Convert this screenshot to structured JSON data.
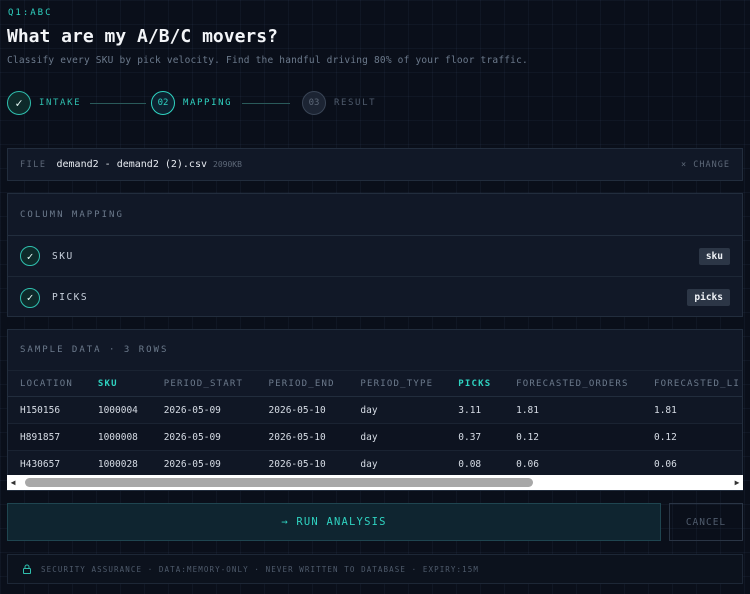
{
  "header": {
    "eyebrow": "Q1:ABC",
    "title": "What are my A/B/C movers?",
    "subtitle": "Classify every SKU by pick velocity. Find the handful driving 80% of your floor traffic."
  },
  "stepper": {
    "steps": [
      {
        "num": "✓",
        "label": "INTAKE",
        "state": "done"
      },
      {
        "num": "02",
        "label": "MAPPING",
        "state": "active"
      },
      {
        "num": "03",
        "label": "RESULT",
        "state": "todo"
      }
    ]
  },
  "file": {
    "key": "FILE",
    "name": "demand2 - demand2 (2).csv",
    "size": "2090KB",
    "change_label": "× CHANGE"
  },
  "mapping": {
    "heading": "COLUMN MAPPING",
    "rows": [
      {
        "label": "SKU",
        "value": "sku"
      },
      {
        "label": "PICKS",
        "value": "picks"
      }
    ]
  },
  "sample": {
    "heading": "SAMPLE DATA · 3 ROWS",
    "columns": [
      "LOCATION",
      "SKU",
      "PERIOD_START",
      "PERIOD_END",
      "PERIOD_TYPE",
      "PICKS",
      "FORECASTED_ORDERS",
      "FORECASTED_LI"
    ],
    "highlighted": [
      "SKU",
      "PICKS"
    ],
    "rows": [
      [
        "H150156",
        "1000004",
        "2026-05-09",
        "2026-05-10",
        "day",
        "3.11",
        "1.81",
        "1.81"
      ],
      [
        "H891857",
        "1000008",
        "2026-05-09",
        "2026-05-10",
        "day",
        "0.37",
        "0.12",
        "0.12"
      ],
      [
        "H430657",
        "1000028",
        "2026-05-09",
        "2026-05-10",
        "day",
        "0.08",
        "0.06",
        "0.06"
      ]
    ]
  },
  "actions": {
    "run_label": "→ RUN ANALYSIS",
    "cancel_label": "CANCEL"
  },
  "security": {
    "text": "SECURITY ASSURANCE · DATA:MEMORY-ONLY · NEVER WRITTEN TO DATABASE · EXPIRY:15M"
  },
  "colors": {
    "accent": "#2fd3c1",
    "background": "#0a0f1a",
    "panel": "#111827"
  }
}
